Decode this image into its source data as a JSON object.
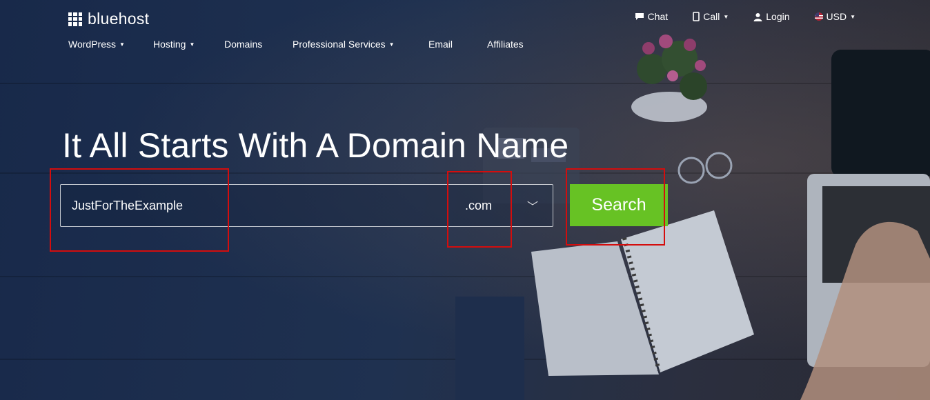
{
  "brand": {
    "name": "bluehost"
  },
  "top_links": [
    {
      "label": "Chat",
      "icon": "chat-bubble-icon"
    },
    {
      "label": "Call",
      "icon": "phone-icon",
      "dropdown": true
    },
    {
      "label": "Login",
      "icon": "user-icon"
    },
    {
      "label": "USD",
      "icon": "us-flag-icon",
      "dropdown": true
    }
  ],
  "nav": [
    {
      "label": "WordPress",
      "dropdown": true
    },
    {
      "label": "Hosting",
      "dropdown": true
    },
    {
      "label": "Domains",
      "dropdown": false
    },
    {
      "label": "Professional Services",
      "dropdown": true
    },
    {
      "label": "Email",
      "dropdown": false
    },
    {
      "label": "Affiliates",
      "dropdown": false
    }
  ],
  "hero": {
    "title": "It All Starts With A Domain Name",
    "domain_value": "JustForTheExample",
    "tld_selected": ".com",
    "search_label": "Search"
  },
  "colors": {
    "accent_green": "#67c224",
    "annotation_red": "#d40d0d",
    "background": "#1d2f4c"
  }
}
